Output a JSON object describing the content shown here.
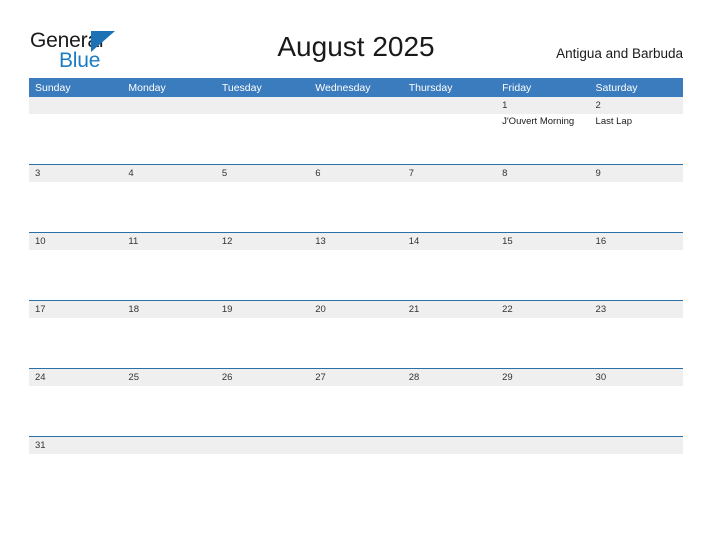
{
  "brand": {
    "word_one": "General",
    "word_two": "Blue",
    "flag_icon": "triangle-flag-icon",
    "accent_color": "#1c72b5"
  },
  "header": {
    "title": "August 2025",
    "region": "Antigua and Barbuda"
  },
  "theme": {
    "header_bar_color": "#3b7cbe",
    "week_divider_color": "#2a6fa8",
    "daynum_band_color": "#efefef",
    "page_background": "#ffffff",
    "text_color": "#1a1a1a"
  },
  "calendar": {
    "weekdays": [
      "Sunday",
      "Monday",
      "Tuesday",
      "Wednesday",
      "Thursday",
      "Friday",
      "Saturday"
    ],
    "weeks": [
      {
        "days": [
          {
            "number": "",
            "events": []
          },
          {
            "number": "",
            "events": []
          },
          {
            "number": "",
            "events": []
          },
          {
            "number": "",
            "events": []
          },
          {
            "number": "",
            "events": []
          },
          {
            "number": "1",
            "events": [
              "J'Ouvert Morning"
            ]
          },
          {
            "number": "2",
            "events": [
              "Last Lap"
            ]
          }
        ]
      },
      {
        "days": [
          {
            "number": "3",
            "events": []
          },
          {
            "number": "4",
            "events": []
          },
          {
            "number": "5",
            "events": []
          },
          {
            "number": "6",
            "events": []
          },
          {
            "number": "7",
            "events": []
          },
          {
            "number": "8",
            "events": []
          },
          {
            "number": "9",
            "events": []
          }
        ]
      },
      {
        "days": [
          {
            "number": "10",
            "events": []
          },
          {
            "number": "11",
            "events": []
          },
          {
            "number": "12",
            "events": []
          },
          {
            "number": "13",
            "events": []
          },
          {
            "number": "14",
            "events": []
          },
          {
            "number": "15",
            "events": []
          },
          {
            "number": "16",
            "events": []
          }
        ]
      },
      {
        "days": [
          {
            "number": "17",
            "events": []
          },
          {
            "number": "18",
            "events": []
          },
          {
            "number": "19",
            "events": []
          },
          {
            "number": "20",
            "events": []
          },
          {
            "number": "21",
            "events": []
          },
          {
            "number": "22",
            "events": []
          },
          {
            "number": "23",
            "events": []
          }
        ]
      },
      {
        "days": [
          {
            "number": "24",
            "events": []
          },
          {
            "number": "25",
            "events": []
          },
          {
            "number": "26",
            "events": []
          },
          {
            "number": "27",
            "events": []
          },
          {
            "number": "28",
            "events": []
          },
          {
            "number": "29",
            "events": []
          },
          {
            "number": "30",
            "events": []
          }
        ]
      },
      {
        "days": [
          {
            "number": "31",
            "events": []
          },
          {
            "number": "",
            "events": []
          },
          {
            "number": "",
            "events": []
          },
          {
            "number": "",
            "events": []
          },
          {
            "number": "",
            "events": []
          },
          {
            "number": "",
            "events": []
          },
          {
            "number": "",
            "events": []
          }
        ]
      }
    ]
  }
}
